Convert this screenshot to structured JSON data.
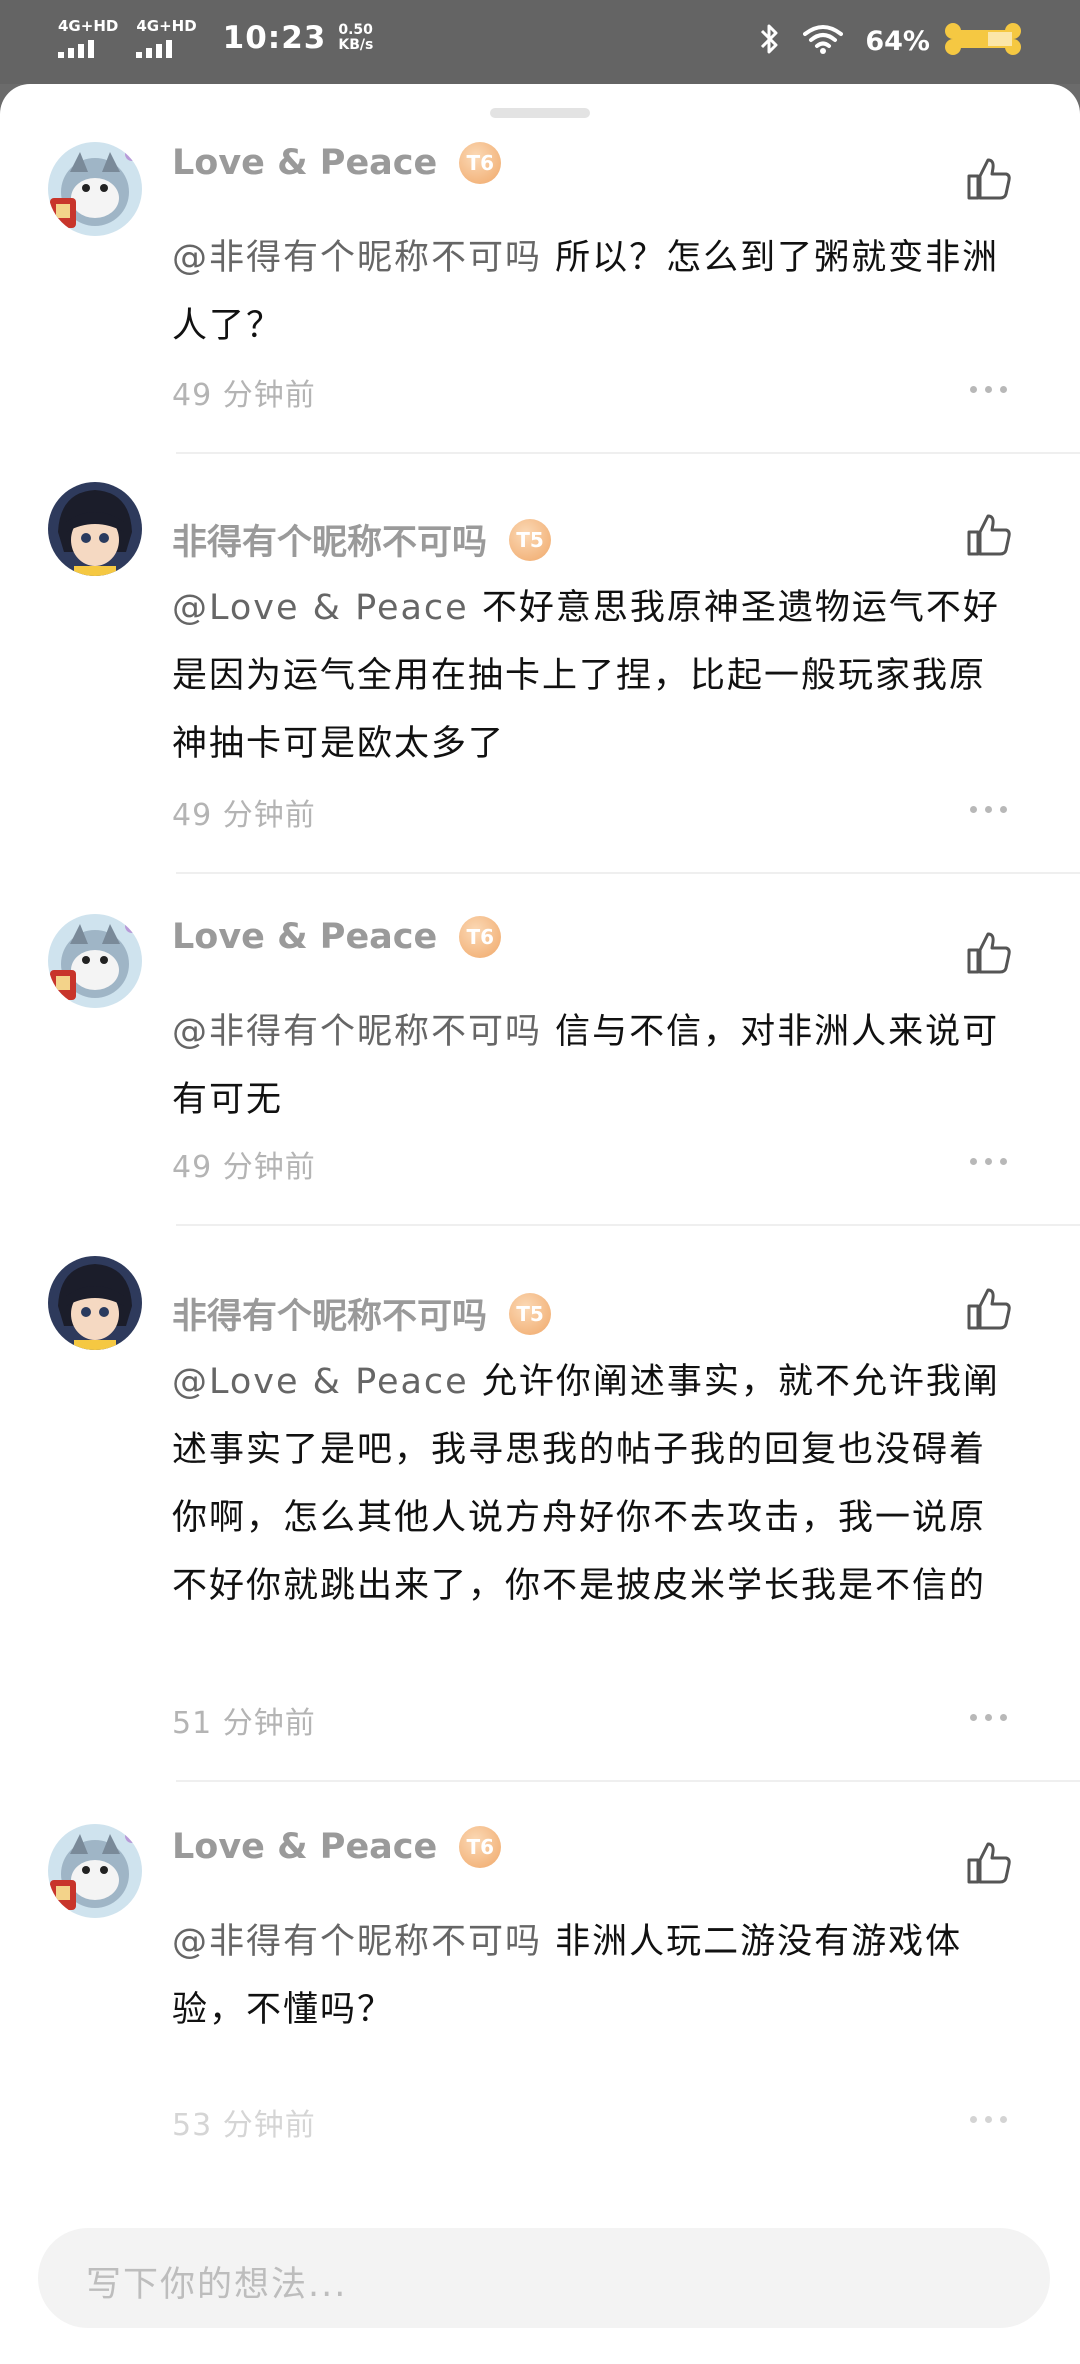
{
  "status_bar": {
    "net1": "4G+HD",
    "net2": "4G+HD",
    "time": "10:23",
    "speed_value": "0.50",
    "speed_unit": "KB/s",
    "battery": "64%"
  },
  "comments": [
    {
      "user": "Love & Peace",
      "level": "T6",
      "mention": "@非得有个昵称不可吗",
      "text": " 所以？怎么到了粥就变非洲人了？",
      "time": "49 分钟前"
    },
    {
      "user": "非得有个昵称不可吗",
      "level": "T5",
      "mention": "@Love & Peace",
      "text": " 不好意思我原神圣遗物运气不好是因为运气全用在抽卡上了捏，比起一般玩家我原神抽卡可是欧太多了",
      "time": "49 分钟前"
    },
    {
      "user": "Love & Peace",
      "level": "T6",
      "mention": "@非得有个昵称不可吗",
      "text": " 信与不信，对非洲人来说可有可无",
      "time": "49 分钟前"
    },
    {
      "user": "非得有个昵称不可吗",
      "level": "T5",
      "mention": "@Love & Peace",
      "text": " 允许你阐述事实，就不允许我阐述事实了是吧，我寻思我的帖子我的回复也没碍着你啊，怎么其他人说方舟好你不去攻击，我一说原不好你就跳出来了，你不是披皮米学长我是不信的",
      "time": "51 分钟前"
    },
    {
      "user": "Love & Peace",
      "level": "T6",
      "mention": "@非得有个昵称不可吗",
      "text": " 非洲人玩二游没有游戏体验，不懂吗？",
      "time": "53 分钟前"
    }
  ],
  "input": {
    "placeholder": "写下你的想法..."
  },
  "colors": {
    "status_bar": "#646464",
    "username": "#9a9a9a",
    "level_badge": "#f0a869",
    "time_text": "#b4b4b4"
  }
}
